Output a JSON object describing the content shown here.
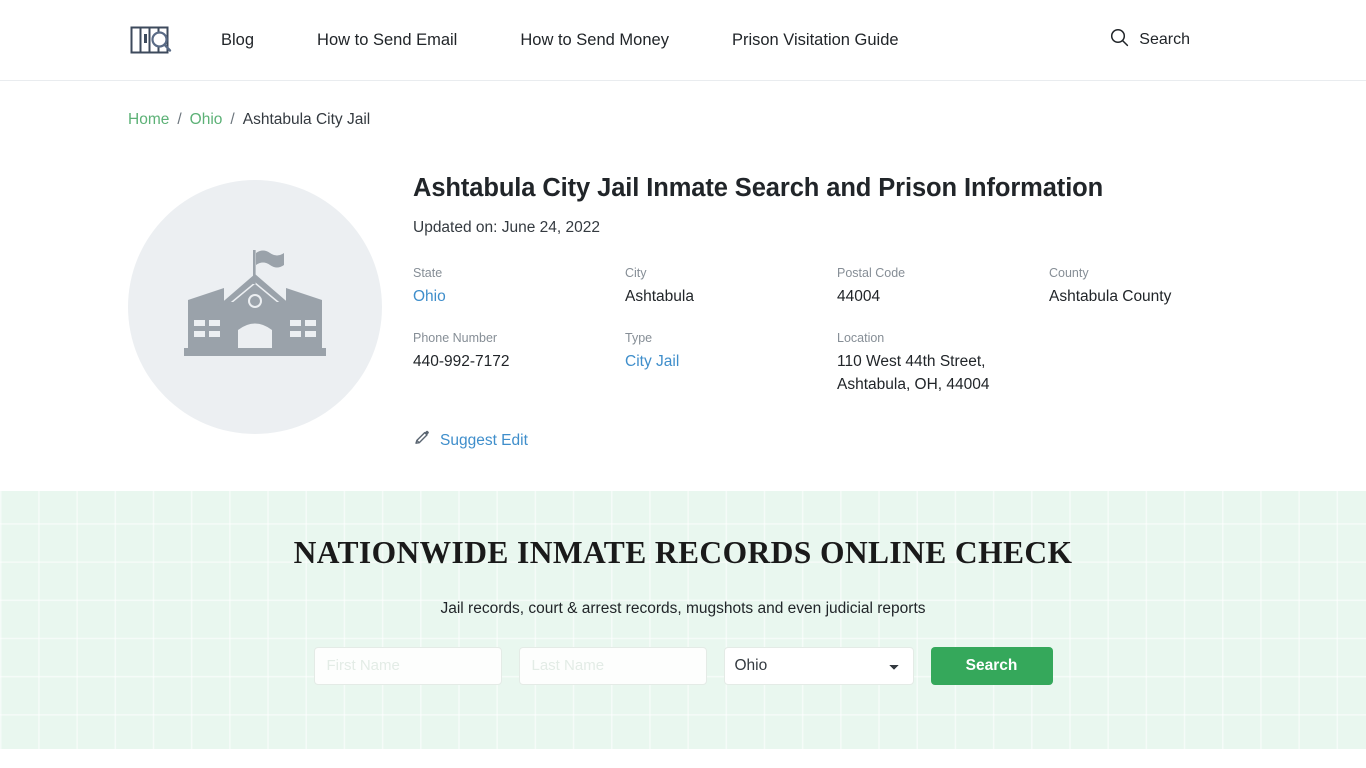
{
  "header": {
    "logo_alt": "prison-bars-search-logo",
    "nav": [
      {
        "label": "Blog"
      },
      {
        "label": "How to Send Email"
      },
      {
        "label": "How to Send Money"
      },
      {
        "label": "Prison Visitation Guide"
      }
    ],
    "search_label": "Search"
  },
  "breadcrumb": {
    "items": [
      {
        "label": "Home",
        "link": true
      },
      {
        "label": "Ohio",
        "link": true
      },
      {
        "label": "Ashtabula City Jail",
        "link": false
      }
    ],
    "separator": "/"
  },
  "facility": {
    "title": "Ashtabula City Jail Inmate Search and Prison Information",
    "updated": "Updated on: June 24, 2022",
    "thumb_icon": "courthouse-building-icon",
    "info": [
      {
        "label": "State",
        "value": "Ohio",
        "link": true
      },
      {
        "label": "City",
        "value": "Ashtabula",
        "link": false
      },
      {
        "label": "Postal Code",
        "value": "44004",
        "link": false
      },
      {
        "label": "County",
        "value": "Ashtabula County",
        "link": false
      },
      {
        "label": "Phone Number",
        "value": "440-992-7172",
        "link": false
      },
      {
        "label": "Type",
        "value": "City Jail",
        "link": true
      },
      {
        "label": "Location",
        "value": "110 West 44th Street, Ashtabula, OH, 44004",
        "link": false
      }
    ],
    "location_line1": "110 West 44th Street,",
    "location_line2": "Ashtabula, OH, 44004",
    "suggest_edit": "Suggest Edit"
  },
  "records": {
    "title": "NATIONWIDE INMATE RECORDS ONLINE CHECK",
    "subtitle": "Jail records, court & arrest records, mugshots and even judicial reports",
    "first_name_placeholder": "First Name",
    "first_name_value": "",
    "last_name_placeholder": "Last Name",
    "last_name_value": "",
    "state_selected": "Ohio",
    "state_options": [
      "Ohio"
    ],
    "search_button": "Search"
  },
  "colors": {
    "brand_green": "#35a85b",
    "breadcrumb_link": "#5cb176",
    "info_link": "#3f8ecb",
    "band_bg": "#e9f7ef",
    "thumb_bg": "#eceff2"
  }
}
